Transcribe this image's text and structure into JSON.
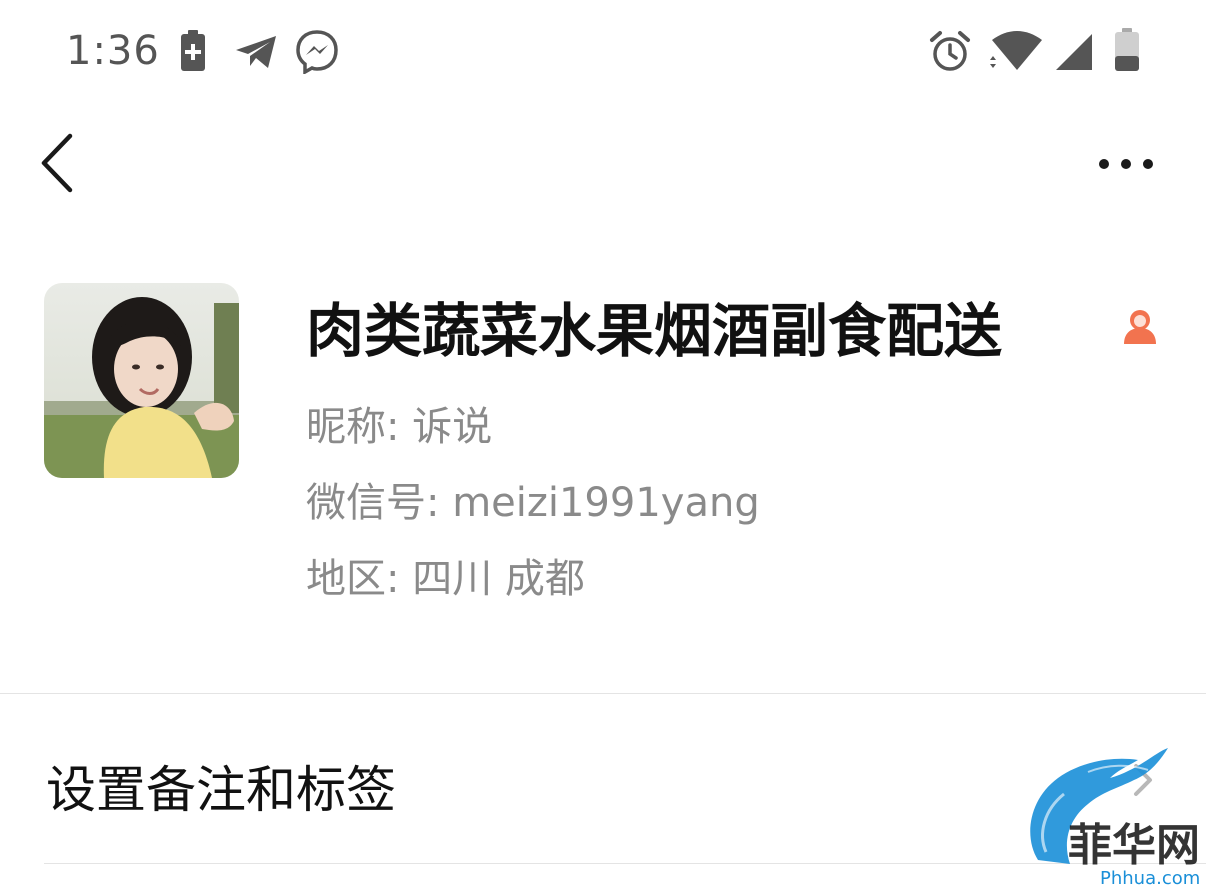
{
  "status_bar": {
    "time": "1:36",
    "left_icons": [
      "battery-saver-icon",
      "telegram-icon",
      "messenger-icon"
    ],
    "right_icons": [
      "alarm-icon",
      "wifi-icon",
      "signal-icon",
      "battery-icon"
    ]
  },
  "nav": {
    "back_icon": "chevron-left-icon",
    "more_icon": "more-icon"
  },
  "profile": {
    "name": "肉类蔬菜水果烟酒副食配送",
    "nickname_line": "昵称: 诉说",
    "wechat_id_line": "微信号: meizi1991yang",
    "region_line": "地区: 四川  成都",
    "gender_icon": "female-icon",
    "accent_color": "#f2734f"
  },
  "menu": {
    "items": [
      {
        "label": "设置备注和标签"
      }
    ]
  },
  "watermark": {
    "text": "菲华网",
    "domain": "Phhua.com",
    "color": "#1a8fd8"
  }
}
